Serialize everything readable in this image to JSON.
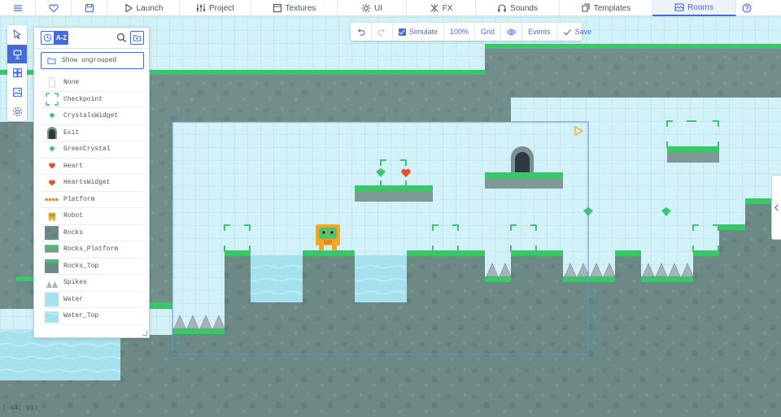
{
  "nav": {
    "tabs": [
      {
        "label": "",
        "icon": "menu-icon"
      },
      {
        "label": "",
        "icon": "heart-icon"
      },
      {
        "label": "",
        "icon": "save-icon"
      },
      {
        "label": "Launch",
        "icon": "play-icon"
      },
      {
        "label": "Project",
        "icon": "sliders-icon"
      },
      {
        "label": "Textures",
        "icon": "texture-icon"
      },
      {
        "label": "UI",
        "icon": "ui-icon"
      },
      {
        "label": "FX",
        "icon": "fx-icon"
      },
      {
        "label": "Sounds",
        "icon": "headphones-icon"
      },
      {
        "label": "Templates",
        "icon": "templates-icon"
      },
      {
        "label": "Rooms",
        "icon": "rooms-icon"
      },
      {
        "label": "",
        "icon": "help-icon"
      }
    ],
    "active": "Rooms"
  },
  "tools": [
    "select-icon",
    "brush-icon",
    "tiles-icon",
    "backgrounds-icon",
    "settings-icon"
  ],
  "panel": {
    "sort_icon": "clock-icon",
    "sort_az": "A-Z",
    "show_ungrouped": "Show ungrouped",
    "templates": [
      {
        "name": "None",
        "icon": "none"
      },
      {
        "name": "Checkpoint",
        "icon": "checkpoint"
      },
      {
        "name": "CrystalsWidget",
        "icon": "crystal"
      },
      {
        "name": "Exit",
        "icon": "exit"
      },
      {
        "name": "GreenCrystal",
        "icon": "crystal"
      },
      {
        "name": "Heart",
        "icon": "heart"
      },
      {
        "name": "HeartsWidget",
        "icon": "heart"
      },
      {
        "name": "Platform",
        "icon": "platform"
      },
      {
        "name": "Robot",
        "icon": "robot"
      },
      {
        "name": "Rocks",
        "icon": "rocks"
      },
      {
        "name": "Rocks_Platform",
        "icon": "rocksplat"
      },
      {
        "name": "Rocks_Top",
        "icon": "rockstop"
      },
      {
        "name": "Spikes",
        "icon": "spikes"
      },
      {
        "name": "Water",
        "icon": "water"
      },
      {
        "name": "Water_Top",
        "icon": "watertop"
      }
    ]
  },
  "roombar": {
    "simulate": "Simulate",
    "zoom": "100%",
    "grid": "Grid",
    "events": "Events",
    "save": "Save"
  },
  "status": {
    "coords": "(-64; 96)"
  },
  "colors": {
    "accent": "#446adb",
    "sky": "#cfeff6",
    "rock": "#6e8a86",
    "grass": "#3ec46d",
    "water": "#a5e2ee"
  }
}
